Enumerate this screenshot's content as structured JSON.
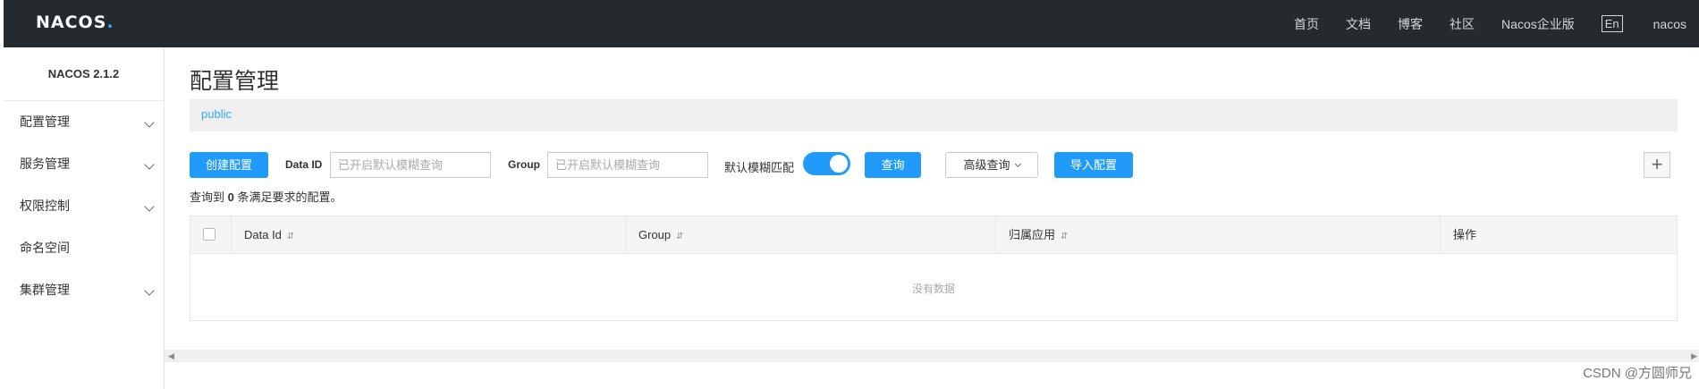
{
  "header": {
    "logo": "NACOS",
    "logo_dot": ".",
    "nav": [
      "首页",
      "文档",
      "博客",
      "社区",
      "Nacos企业版"
    ],
    "lang": "En",
    "user": "nacos"
  },
  "sidebar": {
    "title": "NACOS 2.1.2",
    "items": [
      {
        "label": "配置管理",
        "expandable": true
      },
      {
        "label": "服务管理",
        "expandable": true
      },
      {
        "label": "权限控制",
        "expandable": true
      },
      {
        "label": "命名空间",
        "expandable": false
      },
      {
        "label": "集群管理",
        "expandable": true
      }
    ]
  },
  "main": {
    "title": "配置管理",
    "namespace": "public",
    "toolbar": {
      "create_label": "创建配置",
      "dataid_label": "Data ID",
      "dataid_placeholder": "已开启默认模糊查询",
      "group_label": "Group",
      "group_placeholder": "已开启默认模糊查询",
      "fuzzy_label": "默认模糊匹配",
      "fuzzy_on": true,
      "search_label": "查询",
      "advanced_label": "高级查询",
      "import_label": "导入配置",
      "add_symbol": "+"
    },
    "result": {
      "prefix": "查询到",
      "count": "0",
      "suffix": "条满足要求的配置。"
    },
    "table": {
      "columns": [
        "Data Id",
        "Group",
        "归属应用",
        "操作"
      ],
      "sort_icon": "⇵",
      "empty_text": "没有数据"
    }
  },
  "watermark": "CSDN @方圆师兄",
  "colors": {
    "topbar": "#252a2f",
    "primary": "#209bfa",
    "link": "#36a9ff"
  }
}
